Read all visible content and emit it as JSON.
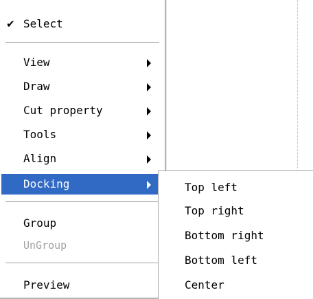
{
  "context_menu": {
    "select_check": "✔",
    "select_label": "Select",
    "items": [
      {
        "label": "View",
        "has_submenu": true
      },
      {
        "label": "Draw",
        "has_submenu": true
      },
      {
        "label": "Cut property",
        "has_submenu": true
      },
      {
        "label": "Tools",
        "has_submenu": true
      },
      {
        "label": "Align",
        "has_submenu": true
      },
      {
        "label": "Docking",
        "has_submenu": true,
        "highlighted": true
      }
    ],
    "group_label": "Group",
    "ungroup_label": "UnGroup",
    "ungroup_enabled": false,
    "preview_label": "Preview"
  },
  "docking_submenu": {
    "items": [
      {
        "label": "Top left"
      },
      {
        "label": "Top right"
      },
      {
        "label": "Bottom right"
      },
      {
        "label": "Bottom left"
      },
      {
        "label": "Center"
      }
    ]
  },
  "colors": {
    "highlight": "#316ac5",
    "disabled_text": "#a0a0a0"
  }
}
